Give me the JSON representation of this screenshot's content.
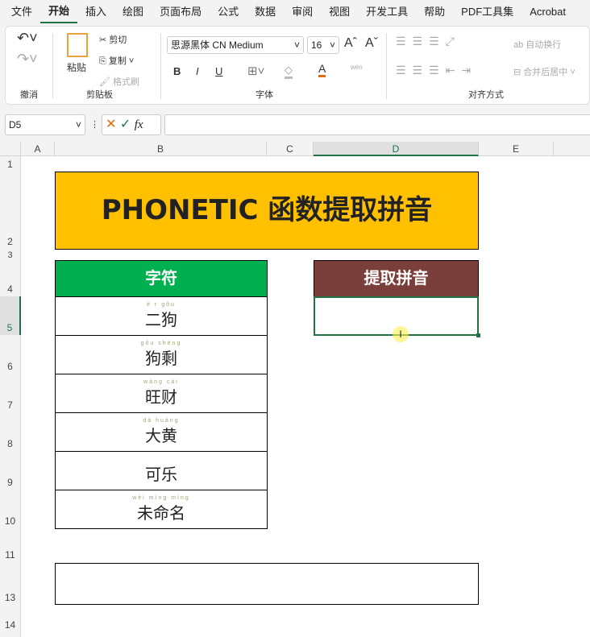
{
  "menu": [
    "文件",
    "开始",
    "插入",
    "绘图",
    "页面布局",
    "公式",
    "数据",
    "审阅",
    "视图",
    "开发工具",
    "帮助",
    "PDF工具集",
    "Acrobat"
  ],
  "ribbon": {
    "undo_group": "撤消",
    "clipboard": {
      "paste": "粘贴",
      "cut": "剪切",
      "copy": "复制",
      "format_painter": "格式刷",
      "label": "剪贴板"
    },
    "font": {
      "name": "思源黑体 CN Medium",
      "size": "16",
      "bold": "B",
      "italic": "I",
      "underline": "U",
      "font_color": "A",
      "label": "字体",
      "phonetic": "wén"
    },
    "alignment": {
      "wrap": "自动换行",
      "merge": "合并后居中",
      "label": "对齐方式"
    },
    "accent": "#217346"
  },
  "formula_bar": {
    "name_box": "D5",
    "fx": "fx",
    "value": ""
  },
  "columns": [
    "A",
    "B",
    "C",
    "D",
    "E"
  ],
  "rows": [
    "1",
    "2",
    "3",
    "4",
    "5",
    "6",
    "7",
    "8",
    "9",
    "10",
    "11",
    "13",
    "14"
  ],
  "sheet": {
    "title": "PHONETIC 函数提取拼音",
    "title_bg": "#ffc000",
    "header_left": "字符",
    "header_left_bg": "#00b050",
    "header_right": "提取拼音",
    "header_right_bg": "#7b3f3b",
    "items": [
      {
        "pinyin": "è r gǒu",
        "text": "二狗"
      },
      {
        "pinyin": "gǒu shèng",
        "text": "狗剩"
      },
      {
        "pinyin": "wàng cái",
        "text": "旺财"
      },
      {
        "pinyin": "dà huáng",
        "text": "大黄"
      },
      {
        "pinyin": "",
        "text": "可乐"
      },
      {
        "pinyin": "wèi mìng míng",
        "text": "未命名"
      }
    ]
  }
}
